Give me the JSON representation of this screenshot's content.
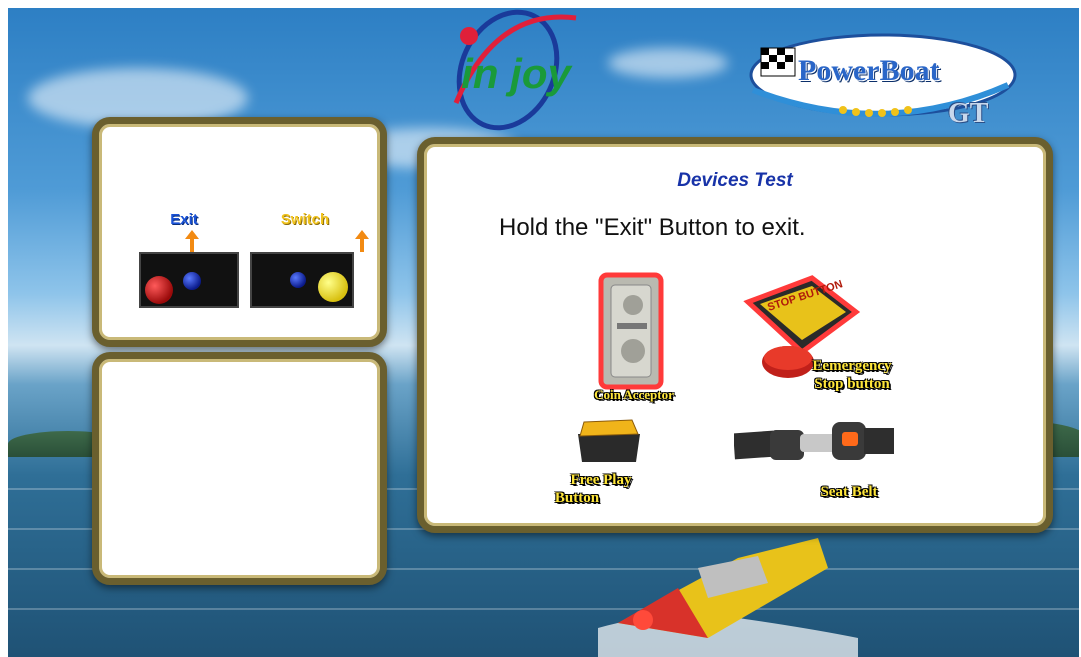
{
  "header": {
    "left_logo_text": "in joy",
    "right_logo_line1": "PowerBoat",
    "right_logo_line2": "GT"
  },
  "buttons_panel": {
    "exit_label": "Exit",
    "switch_label": "Switch"
  },
  "main_panel": {
    "title": "Devices Test",
    "instruction": "Hold the \"Exit\" Button to exit.",
    "devices": {
      "coin_acceptor": "Coin Acceptor",
      "emergency_line1": "Eemergency",
      "emergency_line2": "Stop button",
      "stop_button_text": "STOP BUTTON",
      "free_play_line1": "Free Play",
      "free_play_line2": "Button",
      "seat_belt": "Seat Belt"
    }
  },
  "colors": {
    "exit_label": "#1a52d6",
    "switch_label": "#f0c21a",
    "title": "#1833a8",
    "device_label": "#ffe63a",
    "panel_border": "#6a5f2e"
  }
}
